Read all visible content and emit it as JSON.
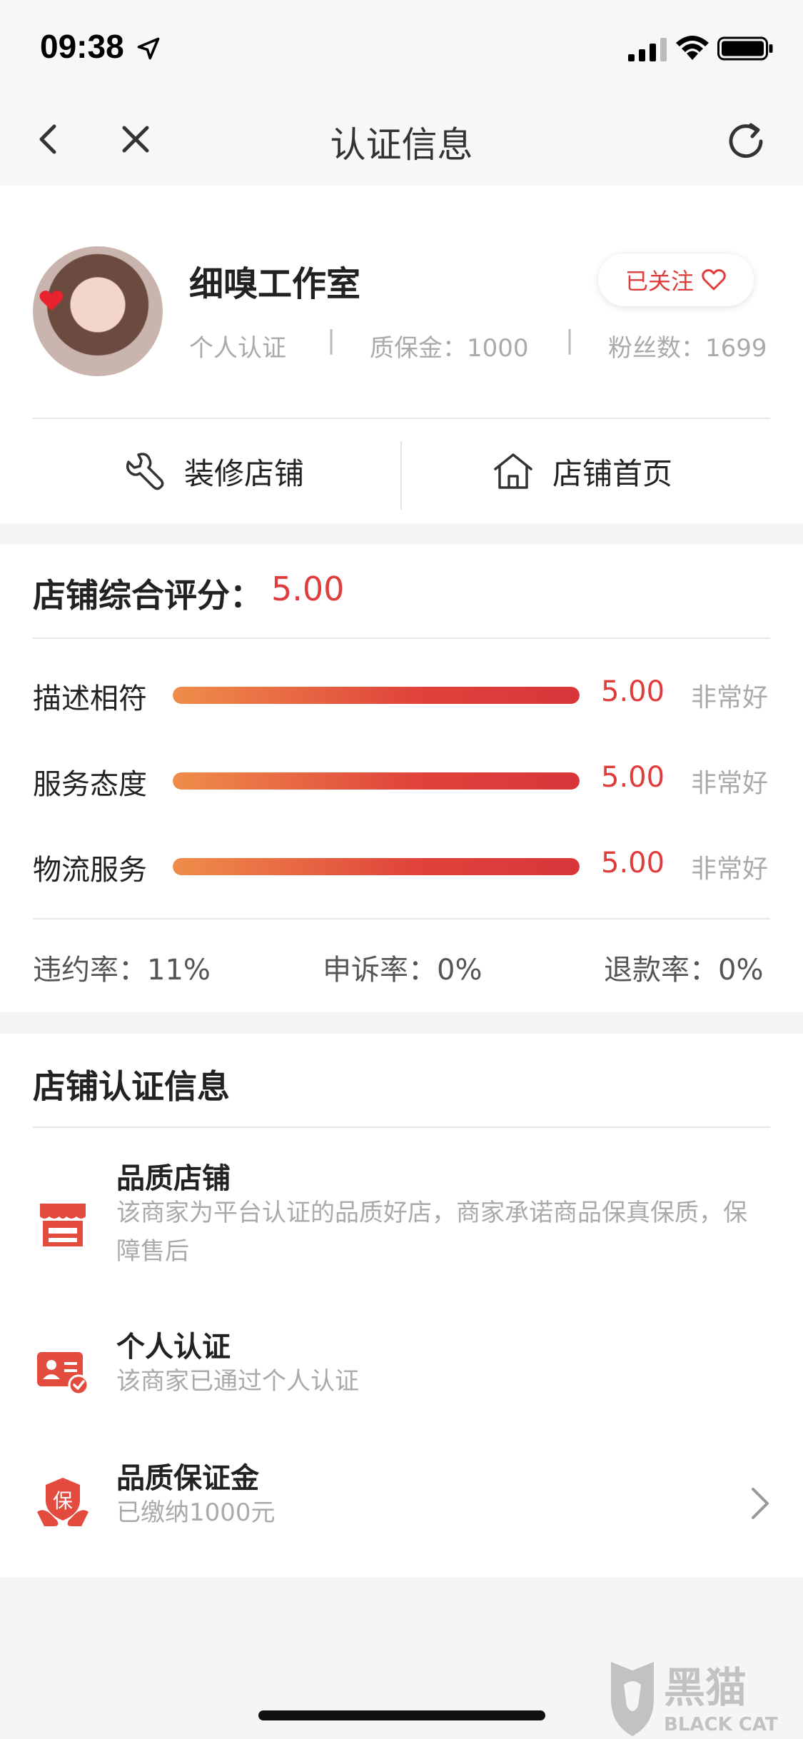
{
  "status_bar": {
    "time": "09:38"
  },
  "nav": {
    "title": "认证信息"
  },
  "shop": {
    "name": "细嗅工作室",
    "follow_label": "已关注",
    "meta": {
      "cert_type": "个人认证",
      "deposit": "质保金：1000",
      "fans": "粉丝数：1699"
    },
    "actions": {
      "decorate": "装修店铺",
      "homepage": "店铺首页"
    }
  },
  "score": {
    "title": "店铺综合评分：",
    "value": "5.00",
    "ratings": [
      {
        "label": "描述相符",
        "value": "5.00",
        "text": "非常好",
        "fill": 1.0
      },
      {
        "label": "服务态度",
        "value": "5.00",
        "text": "非常好",
        "fill": 1.0
      },
      {
        "label": "物流服务",
        "value": "5.00",
        "text": "非常好",
        "fill": 1.0
      }
    ],
    "stats": {
      "violation": "违约率：11%",
      "appeal": "申诉率：0%",
      "refund": "退款率：0%"
    }
  },
  "certification": {
    "title": "店铺认证信息",
    "items": [
      {
        "name": "品质店铺",
        "desc": "该商家为平台认证的品质好店，商家承诺商品保真保质，保障售后",
        "icon": "store-icon"
      },
      {
        "name": "个人认证",
        "desc": "该商家已通过个人认证",
        "icon": "id-card-icon"
      },
      {
        "name": "品质保证金",
        "desc": "已缴纳1000元",
        "icon": "deposit-shield-icon"
      }
    ],
    "deposit_icon_char": "保"
  },
  "watermark": {
    "text": "黑猫",
    "subtext": "BLACK CAT"
  },
  "colors": {
    "accent": "#e03c3c",
    "bar_start": "#ef8d4a",
    "bar_end": "#d8363a"
  }
}
